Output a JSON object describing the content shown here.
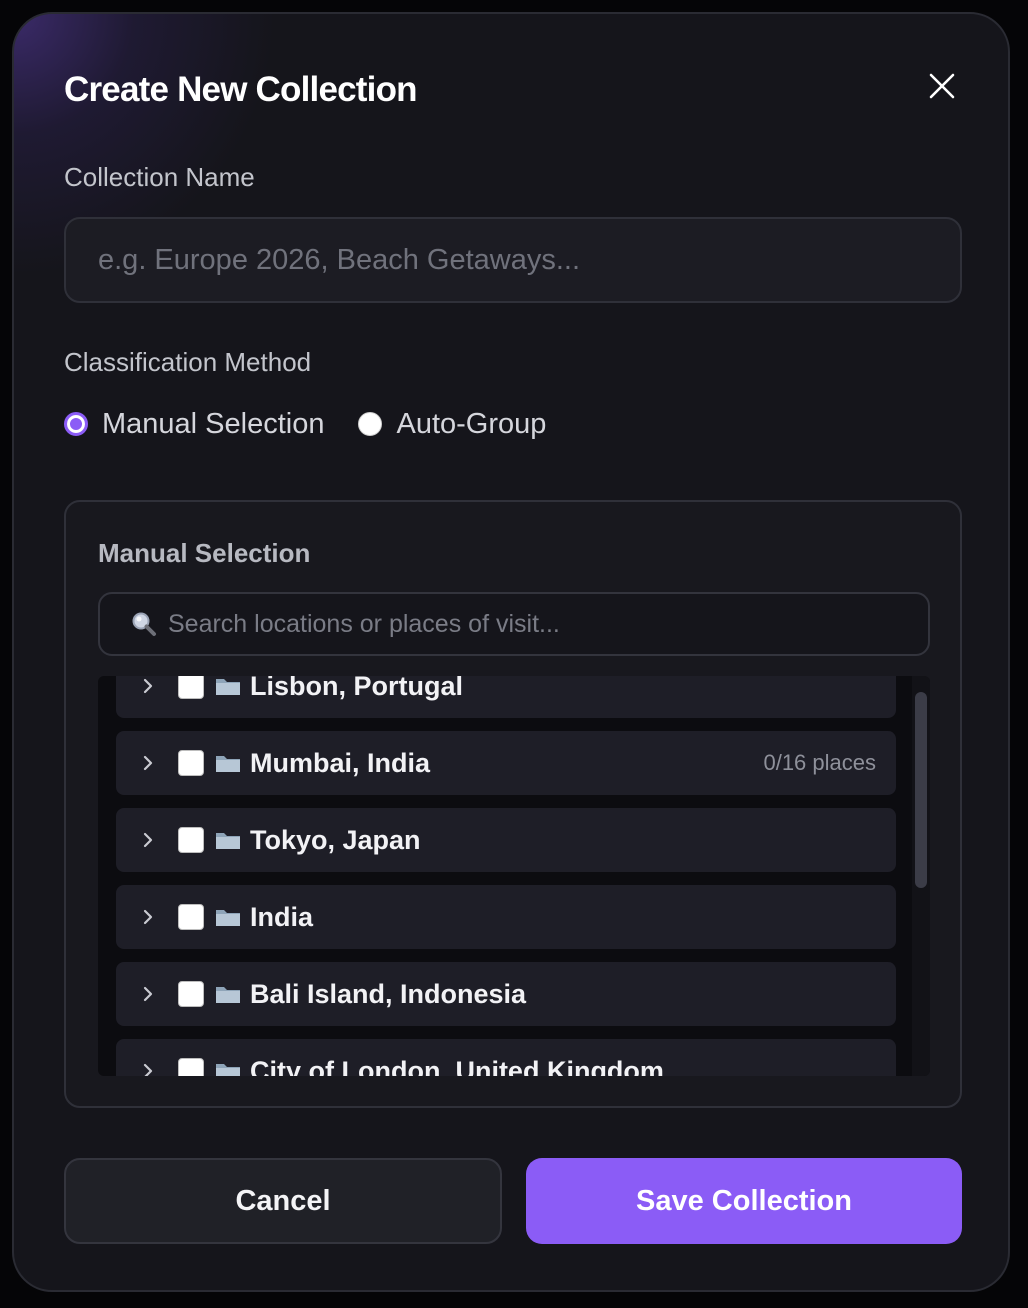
{
  "modal": {
    "title": "Create New Collection",
    "close_icon": "close-icon"
  },
  "collection_name": {
    "label": "Collection Name",
    "value": "",
    "placeholder": "e.g. Europe 2026, Beach Getaways..."
  },
  "classification": {
    "label": "Classification Method",
    "options": [
      {
        "label": "Manual Selection",
        "selected": true
      },
      {
        "label": "Auto-Group",
        "selected": false
      }
    ]
  },
  "manual_selection": {
    "title": "Manual Selection",
    "search": {
      "icon": "search-icon",
      "value": "",
      "placeholder": "Search locations or places of visit..."
    },
    "locations": [
      {
        "name": "Lisbon, Portugal",
        "count": "",
        "checked": false
      },
      {
        "name": "Mumbai, India",
        "count": "0/16 places",
        "checked": false
      },
      {
        "name": "Tokyo, Japan",
        "count": "",
        "checked": false
      },
      {
        "name": "India",
        "count": "",
        "checked": false
      },
      {
        "name": "Bali Island, Indonesia",
        "count": "",
        "checked": false
      },
      {
        "name": "City of London, United Kingdom",
        "count": "",
        "checked": false
      }
    ]
  },
  "actions": {
    "cancel_label": "Cancel",
    "save_label": "Save Collection"
  },
  "colors": {
    "accent": "#8b5cf6",
    "background": "#15151b",
    "row_background": "#1e1e27"
  }
}
